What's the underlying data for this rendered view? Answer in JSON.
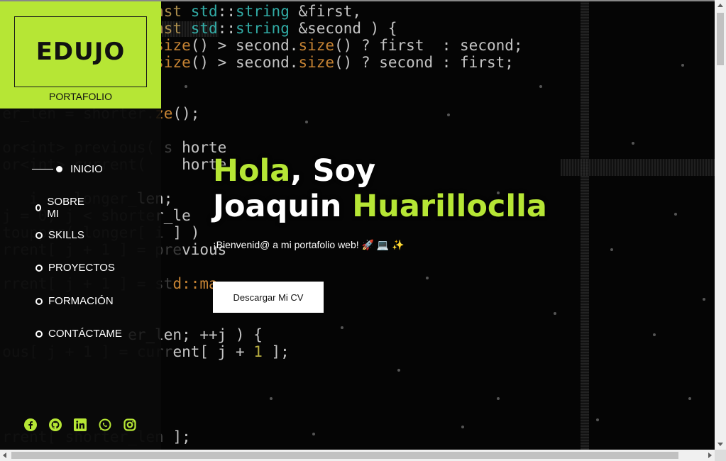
{
  "brand": {
    "name": "EDUJO",
    "subtitle": "PORTAFOLIO",
    "bg_color": "#b6e635"
  },
  "nav": {
    "items": [
      {
        "label": "INICIO",
        "active": true
      },
      {
        "label": "SOBRE MI",
        "active": false
      },
      {
        "label": "SKILLS",
        "active": false
      },
      {
        "label": "PROYECTOS",
        "active": false
      },
      {
        "label": "FORMACIÓN",
        "active": false
      },
      {
        "label": "CONTÁCTAME",
        "active": false
      }
    ]
  },
  "socials": [
    "facebook-icon",
    "github-icon",
    "linkedin-icon",
    "whatsapp-icon",
    "instagram-icon"
  ],
  "hero": {
    "title_hl_1": "Hola",
    "title_rest_1": ", Soy",
    "title_first": "Joaquin ",
    "title_hl_2": "Huarilloclla",
    "subtitle": "¡Bienvenid@ a mi portafolio web! 🚀 💻 ✨",
    "cta_label": "Descargar Mi CV"
  },
  "colors": {
    "accent": "#b6e635",
    "background": "#050505"
  }
}
